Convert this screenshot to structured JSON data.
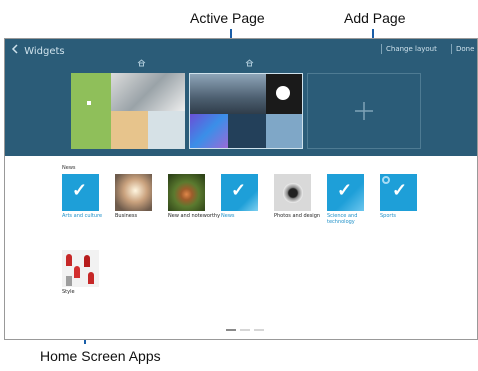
{
  "callouts": {
    "active_page": "Active Page",
    "add_page": "Add Page",
    "home_screen_apps": "Home Screen Apps"
  },
  "header": {
    "back_icon": "chevron-left-icon",
    "title": "Widgets",
    "change_layout": "Change layout",
    "done": "Done"
  },
  "pages": {
    "add_icon": "plus-icon",
    "home_marker_icon": "home-icon"
  },
  "apps_section": {
    "label": "News",
    "items": [
      {
        "label": "Arts and culture",
        "selected": true,
        "color": "#1e9fd8"
      },
      {
        "label": "Business",
        "selected": false,
        "color": "#caa27e"
      },
      {
        "label": "New and noteworthy",
        "selected": false,
        "color": "#5b7a2f"
      },
      {
        "label": "News",
        "selected": true,
        "color": "#1e9fd8"
      },
      {
        "label": "Photos and design",
        "selected": false,
        "color": "#d9d9d9"
      },
      {
        "label": "Science and technology",
        "selected": true,
        "color": "#1e9fd8"
      },
      {
        "label": "Sports",
        "selected": true,
        "color": "#1e9fd8"
      },
      {
        "label": "Style",
        "selected": false,
        "color": "#e9e9e9"
      }
    ]
  },
  "colors": {
    "header_bg": "#2b5c78",
    "accent": "#1e9fd8",
    "callout_line": "#1a5ea8"
  }
}
